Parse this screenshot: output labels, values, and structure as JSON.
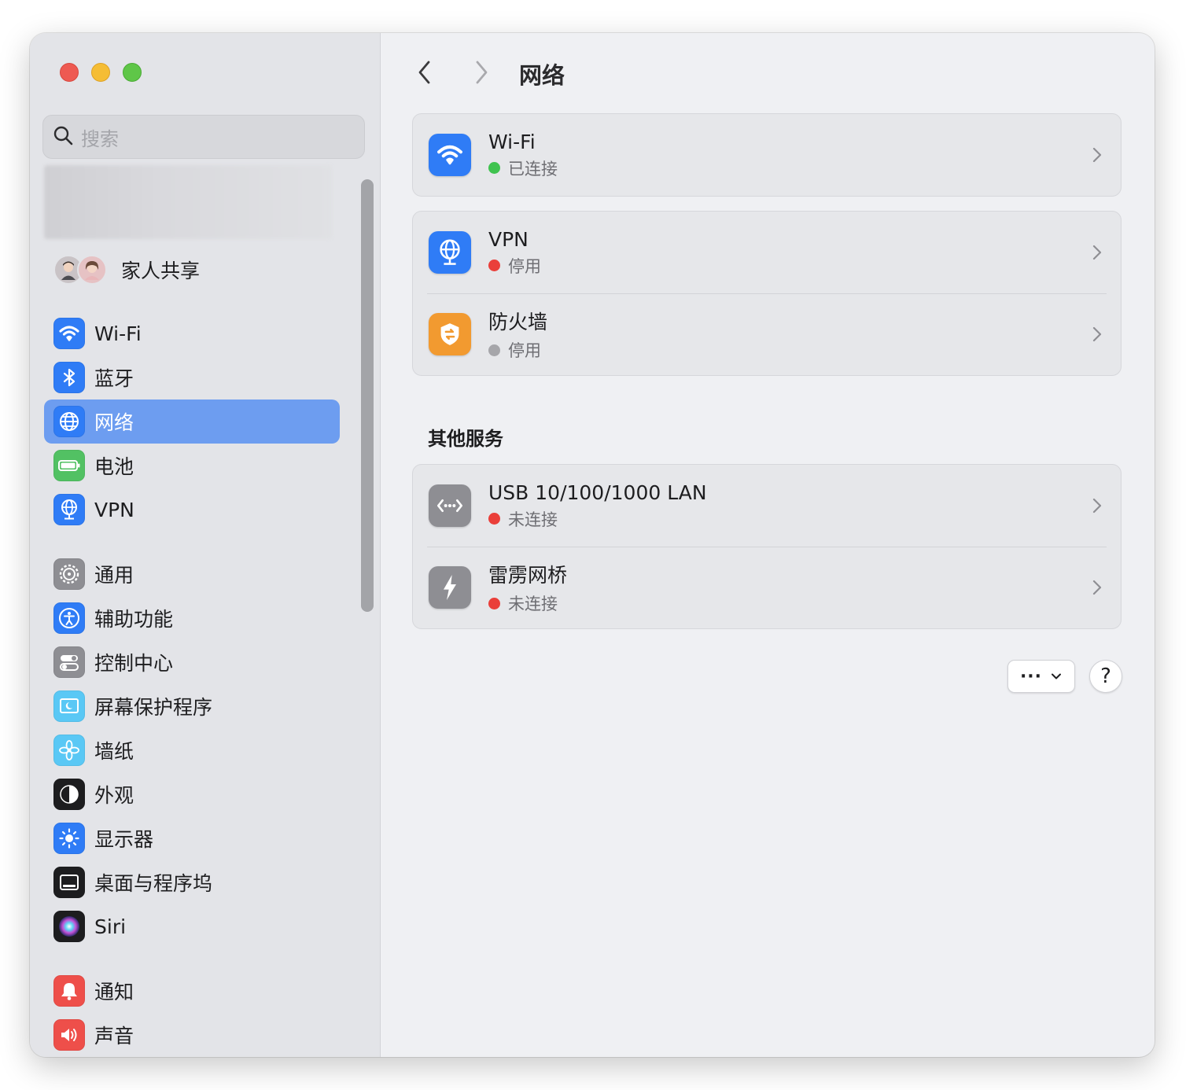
{
  "window": {
    "title": "网络",
    "accent": "#6d9df0"
  },
  "sidebar": {
    "search_placeholder": "搜索",
    "family_label": "家人共享",
    "items": [
      {
        "label": "Wi-Fi",
        "icon": "wifi-icon",
        "color": "#2f7cf6"
      },
      {
        "label": "蓝牙",
        "icon": "bluetooth-icon",
        "color": "#2f7cf6"
      },
      {
        "label": "网络",
        "icon": "globe-icon",
        "color": "#2f7cf6",
        "selected": true
      },
      {
        "label": "电池",
        "icon": "battery-icon",
        "color": "#52c163"
      },
      {
        "label": "VPN",
        "icon": "vpn-globe-icon",
        "color": "#2f7cf6"
      },
      {
        "label": "通用",
        "icon": "gear-icon",
        "color": "#8e8e93"
      },
      {
        "label": "辅助功能",
        "icon": "accessibility-icon",
        "color": "#2f7cf6"
      },
      {
        "label": "控制中心",
        "icon": "toggles-icon",
        "color": "#8e8e93"
      },
      {
        "label": "屏幕保护程序",
        "icon": "screensaver-icon",
        "color": "#5ac8f5"
      },
      {
        "label": "墙纸",
        "icon": "flower-icon",
        "color": "#5ac8f5"
      },
      {
        "label": "外观",
        "icon": "appearance-icon",
        "color": "#1d1d1f"
      },
      {
        "label": "显示器",
        "icon": "sun-icon",
        "color": "#2f7cf6"
      },
      {
        "label": "桌面与程序坞",
        "icon": "dock-icon",
        "color": "#1d1d1f"
      },
      {
        "label": "Siri",
        "icon": "siri-icon",
        "color": "#1d1d1f"
      },
      {
        "label": "通知",
        "icon": "bell-icon",
        "color": "#ee4f4a"
      },
      {
        "label": "声音",
        "icon": "speaker-icon",
        "color": "#ee4f4a"
      }
    ]
  },
  "main": {
    "title": "网络",
    "groups": [
      {
        "rows": [
          {
            "title": "Wi-Fi",
            "status": "已连接",
            "status_color": "#3fc34f",
            "icon": "wifi-icon"
          }
        ]
      },
      {
        "rows": [
          {
            "title": "VPN",
            "status": "停用",
            "status_color": "#ea3f3a",
            "icon": "vpn-globe-icon"
          },
          {
            "title": "防火墙",
            "status": "停用",
            "status_color": "#a6a6aa",
            "icon": "firewall-shield-icon"
          }
        ]
      }
    ],
    "other_services_title": "其他服务",
    "services": [
      {
        "title": "USB 10/100/1000 LAN",
        "status": "未连接",
        "status_color": "#ea3f3a",
        "icon": "ethernet-icon"
      },
      {
        "title": "雷雳网桥",
        "status": "未连接",
        "status_color": "#ea3f3a",
        "icon": "thunderbolt-icon"
      }
    ],
    "more_button_label": "···",
    "help_button_label": "?"
  }
}
